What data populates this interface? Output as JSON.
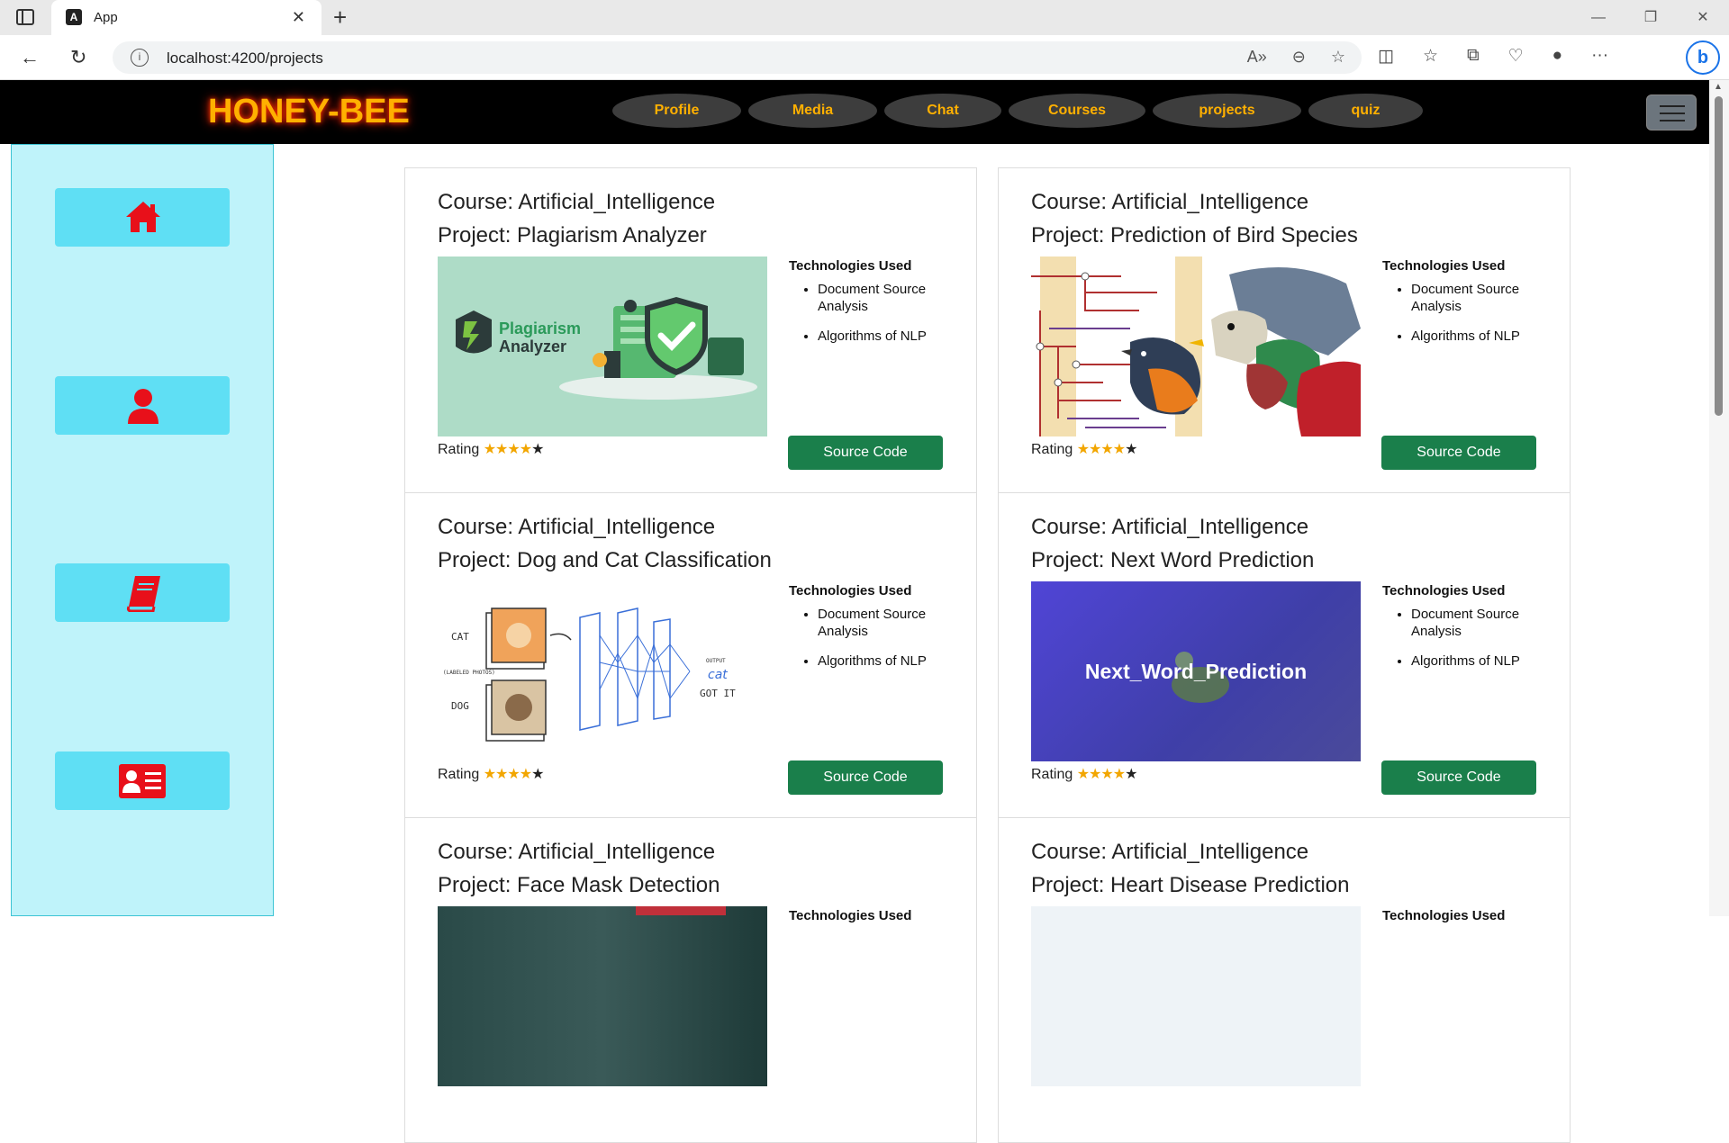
{
  "browser": {
    "tab_title": "App",
    "url": "localhost:4200/projects",
    "window_controls": [
      "minimize-icon",
      "restore-icon",
      "close-icon"
    ]
  },
  "app": {
    "logo": "HONEY-BEE",
    "nav_items": [
      {
        "label": "Profile"
      },
      {
        "label": "Media"
      },
      {
        "label": "Chat"
      },
      {
        "label": "Courses"
      },
      {
        "label": "projects"
      },
      {
        "label": "quiz"
      }
    ],
    "colors": {
      "nav_text": "#ffb000",
      "sidebar_bg": "#bff3fa",
      "sidebar_btn": "#5fdff4",
      "icon_red": "#e8101a",
      "source_btn": "#1a7f4b"
    }
  },
  "sidebar": {
    "items": [
      {
        "icon": "home-icon"
      },
      {
        "icon": "user-icon"
      },
      {
        "icon": "book-icon"
      },
      {
        "icon": "id-card-icon"
      }
    ]
  },
  "cards": [
    {
      "course": "Course: Artificial_Intelligence",
      "project": "Project: Plagiarism Analyzer",
      "tech_title": "Technologies Used",
      "tech": [
        "Document Source Analysis",
        "Algorithms of NLP"
      ],
      "rating_label": "Rating",
      "rating": 4,
      "rating_max": 5,
      "button": "Source Code",
      "image_text": [
        "Plagiarism",
        "Analyzer"
      ]
    },
    {
      "course": "Course: Artificial_Intelligence",
      "project": "Project: Prediction of Bird Species",
      "tech_title": "Technologies Used",
      "tech": [
        "Document Source Analysis",
        "Algorithms of NLP"
      ],
      "rating_label": "Rating",
      "rating": 4,
      "rating_max": 5,
      "button": "Source Code"
    },
    {
      "course": "Course: Artificial_Intelligence",
      "project": "Project: Dog and Cat Classification",
      "tech_title": "Technologies Used",
      "tech": [
        "Document Source Analysis",
        "Algorithms of NLP"
      ],
      "rating_label": "Rating",
      "rating": 4,
      "rating_max": 5,
      "button": "Source Code",
      "image_text": [
        "CAT",
        "(LABELED PHOTOS)",
        "DOG",
        "OUTPUT",
        "cat",
        "GOT IT"
      ]
    },
    {
      "course": "Course: Artificial_Intelligence",
      "project": "Project: Next Word Prediction",
      "tech_title": "Technologies Used",
      "tech": [
        "Document Source Analysis",
        "Algorithms of NLP"
      ],
      "rating_label": "Rating",
      "rating": 4,
      "rating_max": 5,
      "button": "Source Code",
      "image_text": [
        "Next_Word_Prediction"
      ]
    },
    {
      "course": "Course: Artificial_Intelligence",
      "project": "Project: Face Mask Detection",
      "tech_title": "Technologies Used"
    },
    {
      "course": "Course: Artificial_Intelligence",
      "project": "Project: Heart Disease Prediction",
      "tech_title": "Technologies Used"
    }
  ]
}
